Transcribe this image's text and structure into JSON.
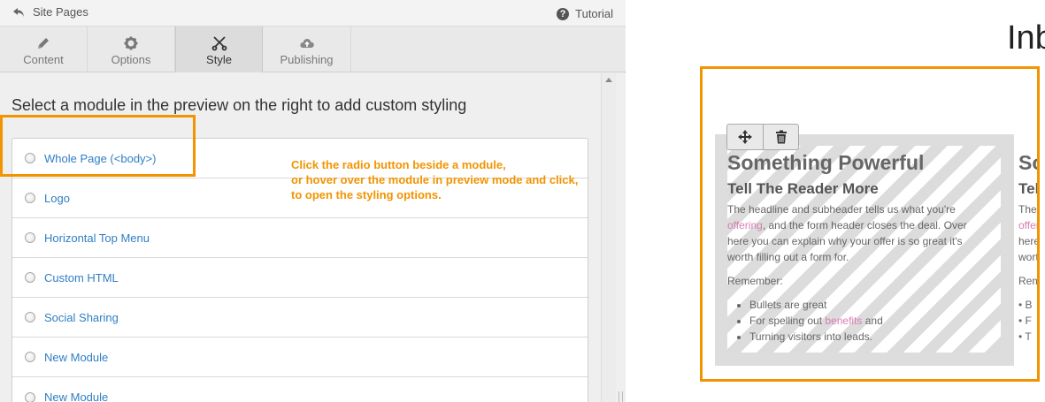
{
  "topbar": {
    "back_label": "Site Pages",
    "tutorial_label": "Tutorial"
  },
  "tabs": [
    {
      "label": "Content",
      "icon": "pencil-icon",
      "active": false
    },
    {
      "label": "Options",
      "icon": "gear-icon",
      "active": false
    },
    {
      "label": "Style",
      "icon": "scissors-icon",
      "active": true
    },
    {
      "label": "Publishing",
      "icon": "cloud-upload-icon",
      "active": false
    }
  ],
  "style_panel": {
    "instructions": "Select a module in the preview on the right to add custom styling",
    "modules": [
      {
        "label": "Whole Page (<body>)"
      },
      {
        "label": "Logo"
      },
      {
        "label": "Horizontal Top Menu"
      },
      {
        "label": "Custom HTML"
      },
      {
        "label": "Social Sharing"
      },
      {
        "label": "New Module"
      },
      {
        "label": "New Module"
      }
    ]
  },
  "callout": {
    "lines": [
      "Click the radio button beside a module,",
      "or hover over the module in preview mode and click,",
      "to open the styling options."
    ],
    "color": "#f29400"
  },
  "preview": {
    "title": "Inb",
    "module": {
      "headline": "Something Powerful",
      "subheadline": "Tell The Reader More",
      "para_line1": "The headline and subheader tells us what you're",
      "para_link1": "offering",
      "para_rest": ", and the form header closes the deal. Over here you can explain why your offer is so great it's worth filling out a form for.",
      "remember": "Remember:",
      "bullet1": "Bullets are great",
      "bullet2_pre": "For spelling out ",
      "bullet2_link": "benefits",
      "bullet2_post": " and",
      "bullet3": "Turning visitors into leads."
    },
    "second_column": {
      "headline": "So",
      "subheadline": "Tell",
      "lines": [
        "The h",
        "offer",
        "here y",
        "worth",
        "",
        "Reme",
        "",
        "• B",
        "• F",
        "• T"
      ]
    },
    "toolbar": {
      "move_icon": "move-icon",
      "delete_icon": "trash-icon"
    }
  },
  "colors": {
    "accent_orange": "#f29400",
    "link_blue": "#2f7fc5",
    "link_pink": "#d67db0"
  }
}
